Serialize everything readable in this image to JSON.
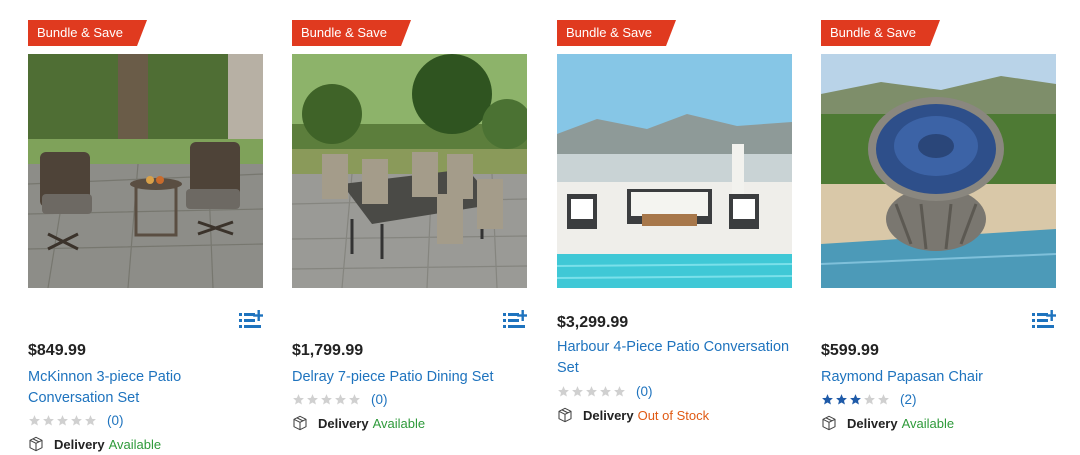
{
  "colors": {
    "badge": "#e03a1f",
    "link": "#1e73be",
    "available": "#2e9a3a",
    "out_of_stock": "#e05a14"
  },
  "products": [
    {
      "badge": "Bundle & Save",
      "price": "$849.99",
      "name": "McKinnon 3-piece Patio Conversation Set",
      "rating": 0,
      "rating_count": "(0)",
      "delivery_label": "Delivery",
      "delivery_status": "Available",
      "list_icon": "add-to-list-icon",
      "delivery_icon": "package-icon"
    },
    {
      "badge": "Bundle & Save",
      "price": "$1,799.99",
      "name": "Delray 7-piece Patio Dining Set",
      "rating": 0,
      "rating_count": "(0)",
      "delivery_label": "Delivery",
      "delivery_status": "Available",
      "list_icon": "add-to-list-icon",
      "delivery_icon": "package-icon"
    },
    {
      "badge": "Bundle & Save",
      "price": "$3,299.99",
      "name": "Harbour 4-Piece Patio Conversation Set",
      "rating": 0,
      "rating_count": "(0)",
      "delivery_label": "Delivery",
      "delivery_status": "Out of Stock",
      "list_icon": "add-to-list-icon",
      "delivery_icon": "package-icon"
    },
    {
      "badge": "Bundle & Save",
      "price": "$599.99",
      "name": "Raymond Papasan Chair",
      "rating": 3,
      "rating_count": "(2)",
      "delivery_label": "Delivery",
      "delivery_status": "Available",
      "list_icon": "add-to-list-icon",
      "delivery_icon": "package-icon"
    }
  ]
}
